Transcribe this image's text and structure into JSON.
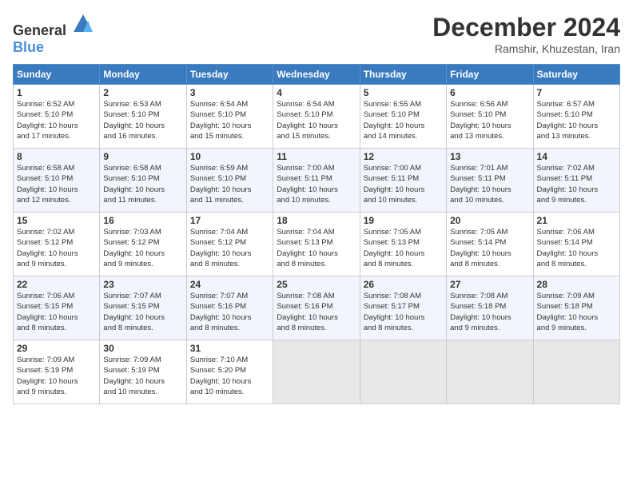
{
  "logo": {
    "text_general": "General",
    "text_blue": "Blue"
  },
  "title": {
    "month": "December 2024",
    "location": "Ramshir, Khuzestan, Iran"
  },
  "calendar": {
    "headers": [
      "Sunday",
      "Monday",
      "Tuesday",
      "Wednesday",
      "Thursday",
      "Friday",
      "Saturday"
    ],
    "rows": [
      [
        {
          "day": "1",
          "info": "Sunrise: 6:52 AM\nSunset: 5:10 PM\nDaylight: 10 hours\nand 17 minutes."
        },
        {
          "day": "2",
          "info": "Sunrise: 6:53 AM\nSunset: 5:10 PM\nDaylight: 10 hours\nand 16 minutes."
        },
        {
          "day": "3",
          "info": "Sunrise: 6:54 AM\nSunset: 5:10 PM\nDaylight: 10 hours\nand 15 minutes."
        },
        {
          "day": "4",
          "info": "Sunrise: 6:54 AM\nSunset: 5:10 PM\nDaylight: 10 hours\nand 15 minutes."
        },
        {
          "day": "5",
          "info": "Sunrise: 6:55 AM\nSunset: 5:10 PM\nDaylight: 10 hours\nand 14 minutes."
        },
        {
          "day": "6",
          "info": "Sunrise: 6:56 AM\nSunset: 5:10 PM\nDaylight: 10 hours\nand 13 minutes."
        },
        {
          "day": "7",
          "info": "Sunrise: 6:57 AM\nSunset: 5:10 PM\nDaylight: 10 hours\nand 13 minutes."
        }
      ],
      [
        {
          "day": "8",
          "info": "Sunrise: 6:58 AM\nSunset: 5:10 PM\nDaylight: 10 hours\nand 12 minutes."
        },
        {
          "day": "9",
          "info": "Sunrise: 6:58 AM\nSunset: 5:10 PM\nDaylight: 10 hours\nand 11 minutes."
        },
        {
          "day": "10",
          "info": "Sunrise: 6:59 AM\nSunset: 5:10 PM\nDaylight: 10 hours\nand 11 minutes."
        },
        {
          "day": "11",
          "info": "Sunrise: 7:00 AM\nSunset: 5:11 PM\nDaylight: 10 hours\nand 10 minutes."
        },
        {
          "day": "12",
          "info": "Sunrise: 7:00 AM\nSunset: 5:11 PM\nDaylight: 10 hours\nand 10 minutes."
        },
        {
          "day": "13",
          "info": "Sunrise: 7:01 AM\nSunset: 5:11 PM\nDaylight: 10 hours\nand 10 minutes."
        },
        {
          "day": "14",
          "info": "Sunrise: 7:02 AM\nSunset: 5:11 PM\nDaylight: 10 hours\nand 9 minutes."
        }
      ],
      [
        {
          "day": "15",
          "info": "Sunrise: 7:02 AM\nSunset: 5:12 PM\nDaylight: 10 hours\nand 9 minutes."
        },
        {
          "day": "16",
          "info": "Sunrise: 7:03 AM\nSunset: 5:12 PM\nDaylight: 10 hours\nand 9 minutes."
        },
        {
          "day": "17",
          "info": "Sunrise: 7:04 AM\nSunset: 5:12 PM\nDaylight: 10 hours\nand 8 minutes."
        },
        {
          "day": "18",
          "info": "Sunrise: 7:04 AM\nSunset: 5:13 PM\nDaylight: 10 hours\nand 8 minutes."
        },
        {
          "day": "19",
          "info": "Sunrise: 7:05 AM\nSunset: 5:13 PM\nDaylight: 10 hours\nand 8 minutes."
        },
        {
          "day": "20",
          "info": "Sunrise: 7:05 AM\nSunset: 5:14 PM\nDaylight: 10 hours\nand 8 minutes."
        },
        {
          "day": "21",
          "info": "Sunrise: 7:06 AM\nSunset: 5:14 PM\nDaylight: 10 hours\nand 8 minutes."
        }
      ],
      [
        {
          "day": "22",
          "info": "Sunrise: 7:06 AM\nSunset: 5:15 PM\nDaylight: 10 hours\nand 8 minutes."
        },
        {
          "day": "23",
          "info": "Sunrise: 7:07 AM\nSunset: 5:15 PM\nDaylight: 10 hours\nand 8 minutes."
        },
        {
          "day": "24",
          "info": "Sunrise: 7:07 AM\nSunset: 5:16 PM\nDaylight: 10 hours\nand 8 minutes."
        },
        {
          "day": "25",
          "info": "Sunrise: 7:08 AM\nSunset: 5:16 PM\nDaylight: 10 hours\nand 8 minutes."
        },
        {
          "day": "26",
          "info": "Sunrise: 7:08 AM\nSunset: 5:17 PM\nDaylight: 10 hours\nand 8 minutes."
        },
        {
          "day": "27",
          "info": "Sunrise: 7:08 AM\nSunset: 5:18 PM\nDaylight: 10 hours\nand 9 minutes."
        },
        {
          "day": "28",
          "info": "Sunrise: 7:09 AM\nSunset: 5:18 PM\nDaylight: 10 hours\nand 9 minutes."
        }
      ],
      [
        {
          "day": "29",
          "info": "Sunrise: 7:09 AM\nSunset: 5:19 PM\nDaylight: 10 hours\nand 9 minutes."
        },
        {
          "day": "30",
          "info": "Sunrise: 7:09 AM\nSunset: 5:19 PM\nDaylight: 10 hours\nand 10 minutes."
        },
        {
          "day": "31",
          "info": "Sunrise: 7:10 AM\nSunset: 5:20 PM\nDaylight: 10 hours\nand 10 minutes."
        },
        {
          "day": "",
          "info": ""
        },
        {
          "day": "",
          "info": ""
        },
        {
          "day": "",
          "info": ""
        },
        {
          "day": "",
          "info": ""
        }
      ]
    ]
  }
}
